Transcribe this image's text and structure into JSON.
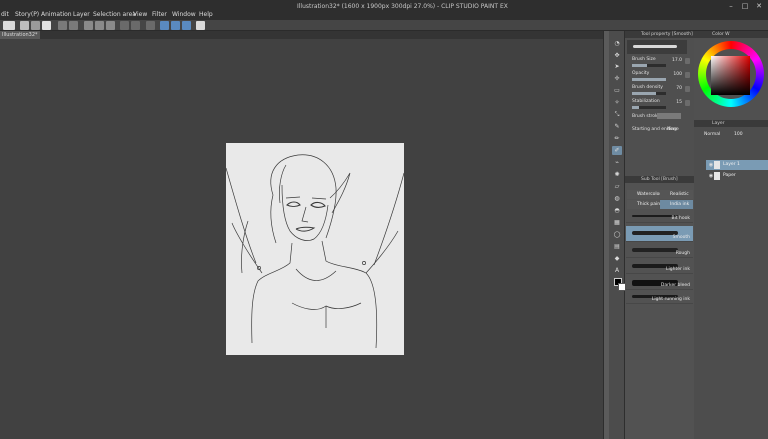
{
  "window": {
    "title": "Illustration32* (1600 x 1900px 300dpi 27.0%) - CLIP STUDIO PAINT EX",
    "controls": [
      "–",
      "□",
      "✕"
    ]
  },
  "menu": [
    "dit",
    "Story(P)",
    "Animation",
    "Layer",
    "Selection area",
    "View",
    "Filter",
    "Window",
    "Help"
  ],
  "document_tab": "Illustration32*",
  "tool_property": {
    "header": "Tool property [Smooth]",
    "brush_size": {
      "label": "Brush Size",
      "value": "17.0",
      "fraction": 0.45
    },
    "opacity": {
      "label": "Opacity",
      "value": "100",
      "fraction": 1.0
    },
    "brush_density": {
      "label": "Brush density",
      "value": "70",
      "fraction": 0.7
    },
    "stabilization": {
      "label": "Stabilization",
      "value": "15",
      "fraction": 0.2
    },
    "brush_stroke": {
      "label": "Brush stroke"
    },
    "starting_ending": {
      "label": "Starting and ending",
      "value": "None"
    }
  },
  "sub_tool": {
    "header": "Sub Tool [Brush]",
    "tabs": [
      "Watercolor",
      "Realistic",
      "Thick paint",
      "India ink"
    ],
    "brushes": [
      "Bit hook",
      "Smooth",
      "Rough",
      "Lighter ink",
      "Darker bleed",
      "Light running ink"
    ]
  },
  "color": {
    "panel_label": "Color W",
    "fg": "#000000",
    "bg": "#ffffff",
    "hue": "#e10000"
  },
  "layer": {
    "tab_label": "Layer",
    "blend_mode": "Normal",
    "opacity_value": "100",
    "layers": [
      {
        "name": "Layer 1",
        "selected": true
      },
      {
        "name": "Paper",
        "selected": false
      }
    ]
  },
  "colors": {
    "accent": "#7a9bb4",
    "panel": "#4f4f4f",
    "canvas_bg": "#414141",
    "paper": "#e9e9e9"
  }
}
